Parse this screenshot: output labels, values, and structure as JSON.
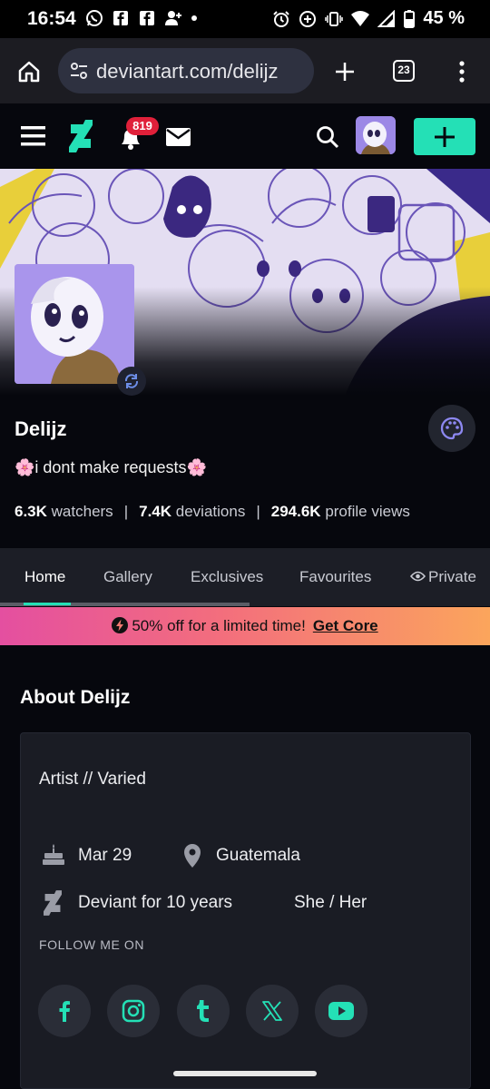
{
  "status_bar": {
    "time": "16:54",
    "battery": "45 %",
    "notification_icons": [
      "whatsapp-icon",
      "facebook-icon",
      "facebook-icon",
      "person-add-icon",
      "dot-icon"
    ],
    "system_icons": [
      "alarm-icon",
      "data-saver-icon",
      "vibrate-icon",
      "wifi-icon",
      "signal-icon",
      "battery-icon"
    ]
  },
  "browser": {
    "url": "deviantart.com/delijz",
    "tab_count": "23"
  },
  "header": {
    "notification_count": "819",
    "accent_color": "#24e0b6"
  },
  "profile": {
    "username": "Delijz",
    "tagline": "🌸i dont make requests🌸",
    "watchers_count": "6.3K",
    "watchers_label": "watchers",
    "deviations_count": "7.4K",
    "deviations_label": "deviations",
    "views_count": "294.6K",
    "views_label": "profile views",
    "separator": "|"
  },
  "tabs": [
    {
      "label": "Home",
      "active": true
    },
    {
      "label": "Gallery",
      "active": false
    },
    {
      "label": "Exclusives",
      "active": false
    },
    {
      "label": "Favourites",
      "active": false
    },
    {
      "label": "Private",
      "active": false
    }
  ],
  "promo": {
    "text": "50% off for a limited time!",
    "cta": "Get Core"
  },
  "about": {
    "title": "About Delijz",
    "bio": "Artist  //  Varied",
    "birthday": "Mar 29",
    "location": "Guatemala",
    "member_since": "Deviant for 10 years",
    "pronouns": "She / Her",
    "follow_label": "FOLLOW ME ON",
    "socials": [
      "facebook-icon",
      "instagram-icon",
      "tumblr-icon",
      "x-icon",
      "youtube-icon"
    ]
  }
}
